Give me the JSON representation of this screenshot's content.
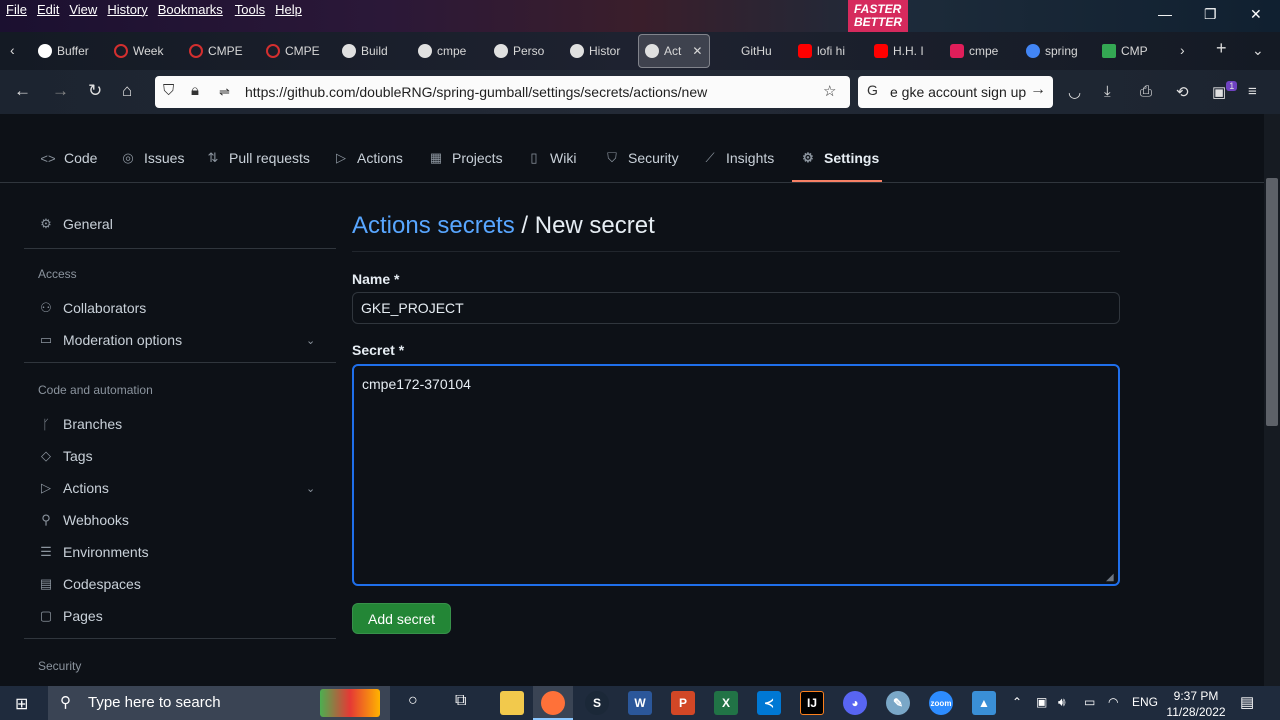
{
  "browser": {
    "menu": [
      "File",
      "Edit",
      "View",
      "History",
      "Bookmarks",
      "Tools",
      "Help"
    ],
    "banner_text": "FASTER BETTER",
    "tabs": [
      {
        "label": "Buffer",
        "color": "#ffffff"
      },
      {
        "label": "Week",
        "color": "#d32f2f"
      },
      {
        "label": "CMPE",
        "color": "#d32f2f"
      },
      {
        "label": "CMPE",
        "color": "#d32f2f"
      },
      {
        "label": "Build",
        "color": "#e0e0e0"
      },
      {
        "label": "cmpe",
        "color": "#e0e0e0"
      },
      {
        "label": "Perso",
        "color": "#e0e0e0"
      },
      {
        "label": "Histor",
        "color": "#e0e0e0"
      },
      {
        "label": "Act",
        "color": "#e0e0e0"
      },
      {
        "label": "GitHu",
        "color": "#e0e0e0"
      },
      {
        "label": "lofi hi",
        "color": "#ff0000"
      },
      {
        "label": "H.H. I",
        "color": "#ff0000"
      },
      {
        "label": "cmpe",
        "color": "#e01e5a"
      },
      {
        "label": "spring",
        "color": "#4285f4"
      },
      {
        "label": "CMP",
        "color": "#34a853"
      }
    ],
    "url": "https://github.com/doubleRNG/spring-gumball/settings/secrets/actions/new",
    "search_text": "e gke account sign up",
    "badge_count": "1"
  },
  "repo_tabs": [
    {
      "label": "Code",
      "icon": "code-icon",
      "glyph": "<>"
    },
    {
      "label": "Issues",
      "icon": "issue-icon",
      "glyph": "◎"
    },
    {
      "label": "Pull requests",
      "icon": "pull-request-icon",
      "glyph": "⇅"
    },
    {
      "label": "Actions",
      "icon": "play-icon",
      "glyph": "▷"
    },
    {
      "label": "Projects",
      "icon": "table-icon",
      "glyph": "▦"
    },
    {
      "label": "Wiki",
      "icon": "book-icon",
      "glyph": "▯"
    },
    {
      "label": "Security",
      "icon": "shield-icon",
      "glyph": "⛉"
    },
    {
      "label": "Insights",
      "icon": "graph-icon",
      "glyph": "⟋"
    },
    {
      "label": "Settings",
      "icon": "gear-icon",
      "glyph": "⚙"
    }
  ],
  "sidebar": {
    "general": "General",
    "access_heading": "Access",
    "access_items": [
      {
        "label": "Collaborators",
        "icon": "people-icon"
      },
      {
        "label": "Moderation options",
        "icon": "comment-icon"
      }
    ],
    "code_heading": "Code and automation",
    "code_items": [
      {
        "label": "Branches",
        "icon": "branch-icon"
      },
      {
        "label": "Tags",
        "icon": "tag-icon"
      },
      {
        "label": "Actions",
        "icon": "play-icon"
      },
      {
        "label": "Webhooks",
        "icon": "webhook-icon"
      },
      {
        "label": "Environments",
        "icon": "server-icon"
      },
      {
        "label": "Codespaces",
        "icon": "codespaces-icon"
      },
      {
        "label": "Pages",
        "icon": "browser-icon"
      }
    ],
    "security_heading": "Security"
  },
  "main": {
    "breadcrumb_link": "Actions secrets",
    "breadcrumb_sep": "/",
    "title": "New secret",
    "name_label": "Name *",
    "name_value": "GKE_PROJECT",
    "secret_label": "Secret *",
    "secret_value": "cmpe172-370104",
    "submit_label": "Add secret"
  },
  "taskbar": {
    "search_placeholder": "Type here to search",
    "language": "ENG",
    "time": "9:37 PM",
    "date": "11/28/2022"
  }
}
